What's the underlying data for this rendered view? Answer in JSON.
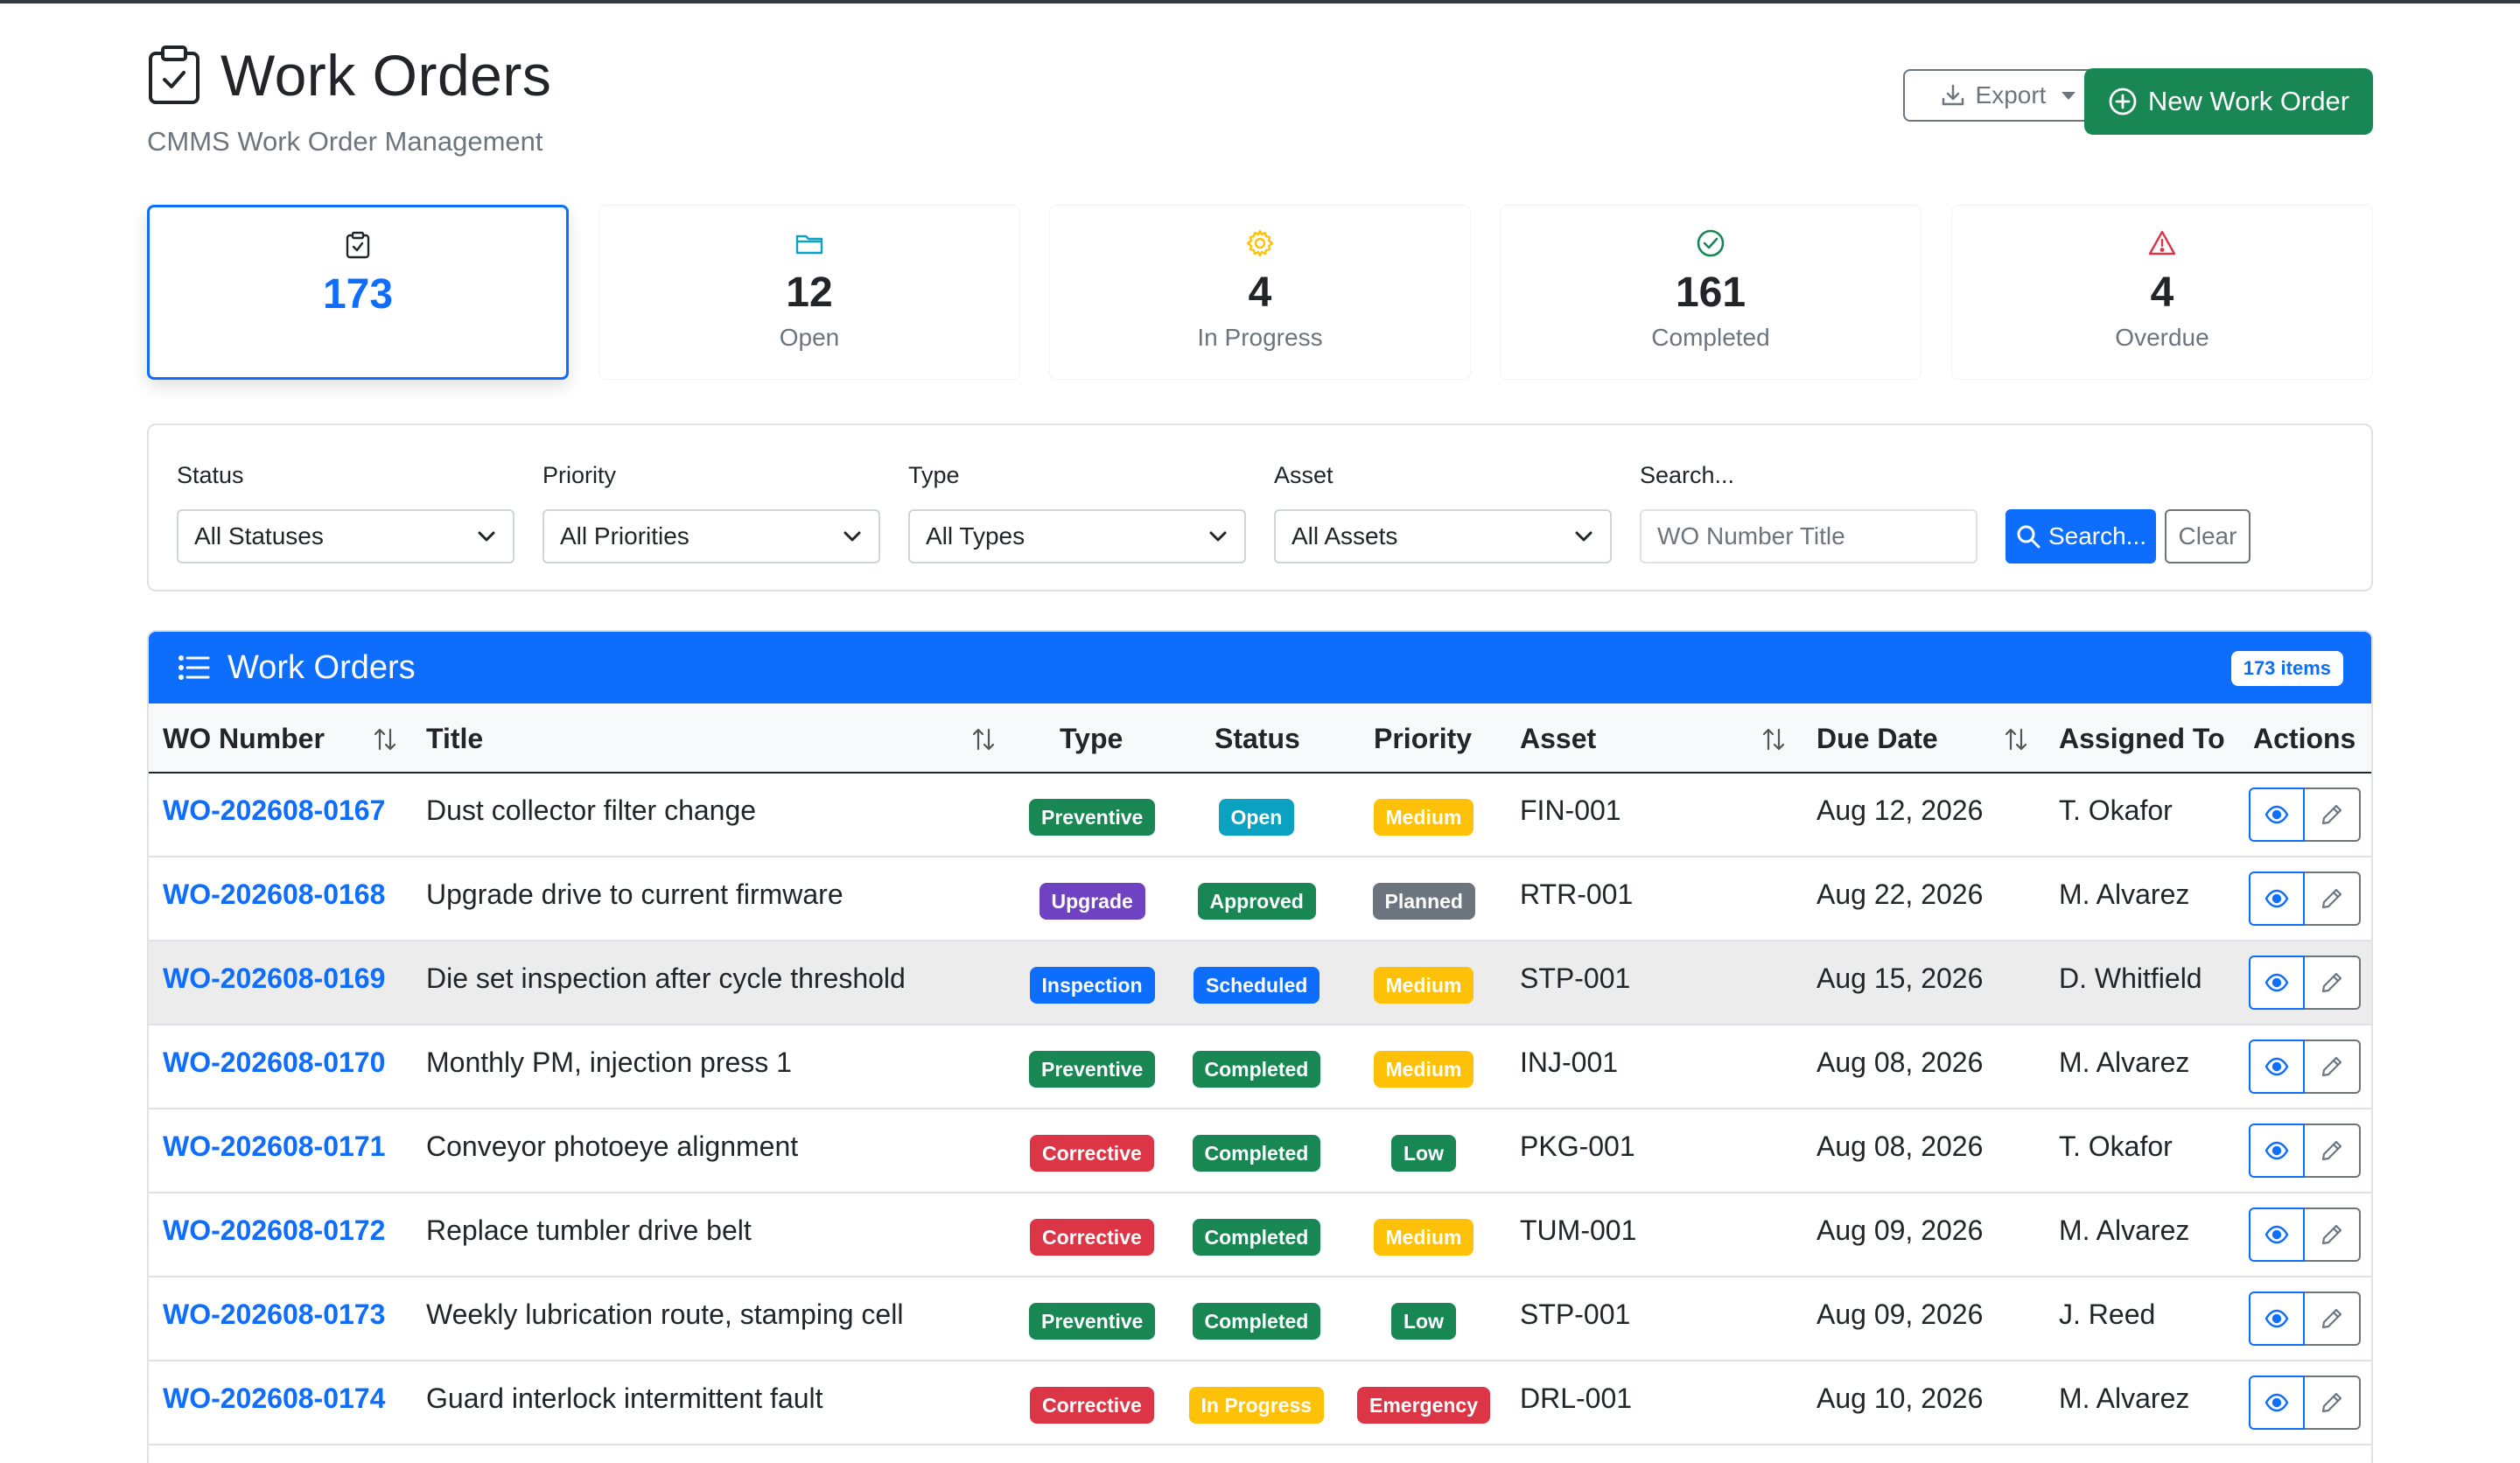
{
  "header": {
    "title": "Work Orders",
    "subtitle": "CMMS Work Order Management",
    "export_label": "Export",
    "new_label": "New Work Order"
  },
  "stats": [
    {
      "value": "173",
      "label": "",
      "icon": "clipboard-check-icon"
    },
    {
      "value": "12",
      "label": "Open",
      "icon": "folder-icon"
    },
    {
      "value": "4",
      "label": "In Progress",
      "icon": "gear-icon"
    },
    {
      "value": "161",
      "label": "Completed",
      "icon": "check-circle-icon"
    },
    {
      "value": "4",
      "label": "Overdue",
      "icon": "warning-triangle-icon"
    }
  ],
  "filters": {
    "status_label": "Status",
    "status_value": "All Statuses",
    "priority_label": "Priority",
    "priority_value": "All Priorities",
    "type_label": "Type",
    "type_value": "All Types",
    "asset_label": "Asset",
    "asset_value": "All Assets",
    "search_label": "Search...",
    "search_placeholder": "WO Number Title",
    "search_button": "Search...",
    "clear_button": "Clear"
  },
  "table": {
    "title": "Work Orders",
    "count_badge": "173 items",
    "columns": {
      "wo": "WO Number",
      "title": "Title",
      "type": "Type",
      "status": "Status",
      "priority": "Priority",
      "asset": "Asset",
      "due": "Due Date",
      "assigned": "Assigned To",
      "actions": "Actions"
    },
    "rows": [
      {
        "wo": "WO-202608-0167",
        "title": "Dust collector filter change",
        "type": "Preventive",
        "status": "Open",
        "priority": "Medium",
        "asset": "FIN-001",
        "due": "Aug 12, 2026",
        "assigned": "T. Okafor"
      },
      {
        "wo": "WO-202608-0168",
        "title": "Upgrade drive to current firmware",
        "type": "Upgrade",
        "status": "Approved",
        "priority": "Planned",
        "asset": "RTR-001",
        "due": "Aug 22, 2026",
        "assigned": "M. Alvarez"
      },
      {
        "wo": "WO-202608-0169",
        "title": "Die set inspection after cycle threshold",
        "type": "Inspection",
        "status": "Scheduled",
        "priority": "Medium",
        "asset": "STP-001",
        "due": "Aug 15, 2026",
        "assigned": "D. Whitfield"
      },
      {
        "wo": "WO-202608-0170",
        "title": "Monthly PM, injection press 1",
        "type": "Preventive",
        "status": "Completed",
        "priority": "Medium",
        "asset": "INJ-001",
        "due": "Aug 08, 2026",
        "assigned": "M. Alvarez"
      },
      {
        "wo": "WO-202608-0171",
        "title": "Conveyor photoeye alignment",
        "type": "Corrective",
        "status": "Completed",
        "priority": "Low",
        "asset": "PKG-001",
        "due": "Aug 08, 2026",
        "assigned": "T. Okafor"
      },
      {
        "wo": "WO-202608-0172",
        "title": "Replace tumbler drive belt",
        "type": "Corrective",
        "status": "Completed",
        "priority": "Medium",
        "asset": "TUM-001",
        "due": "Aug 09, 2026",
        "assigned": "M. Alvarez"
      },
      {
        "wo": "WO-202608-0173",
        "title": "Weekly lubrication route, stamping cell",
        "type": "Preventive",
        "status": "Completed",
        "priority": "Low",
        "asset": "STP-001",
        "due": "Aug 09, 2026",
        "assigned": "J. Reed"
      },
      {
        "wo": "WO-202608-0174",
        "title": "Guard interlock intermittent fault",
        "type": "Corrective",
        "status": "In Progress",
        "priority": "Emergency",
        "asset": "DRL-001",
        "due": "Aug 10, 2026",
        "assigned": "M. Alvarez"
      }
    ]
  },
  "colors": {
    "primary": "#0d6efd",
    "success": "#198754",
    "info": "#0aa2c0",
    "warning": "#ffc107",
    "danger": "#dc3545",
    "purple": "#6f42c1",
    "secondary": "#6c757d"
  }
}
